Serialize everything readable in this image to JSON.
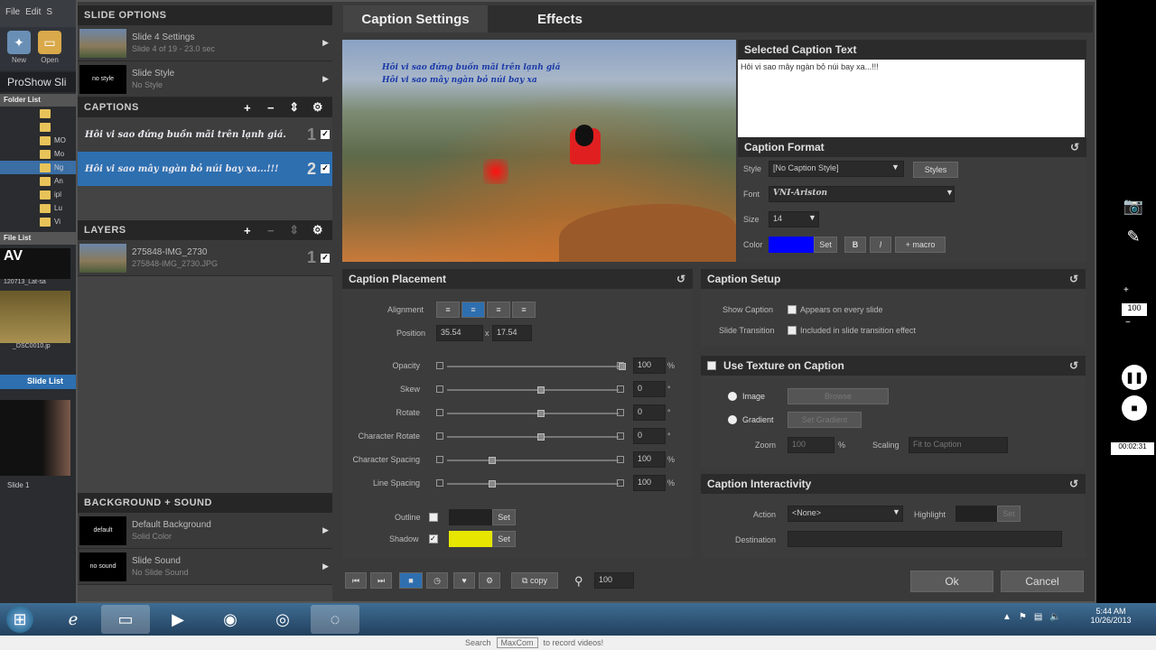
{
  "bg_app": {
    "menu": [
      "File",
      "Edit",
      "S"
    ],
    "tool_new": "New",
    "tool_open": "Open",
    "title": "ProShow Sli",
    "folder_list": "Folder List",
    "folders": [
      "MO",
      "Mo",
      "Ng",
      "An",
      "ipl",
      "Lu",
      "Vi"
    ],
    "file_list": "File List",
    "file1": "120713_Lat-sa",
    "file2": "_DSC0010.jp",
    "slide_list": "Slide List",
    "slide1": "Slide 1"
  },
  "left": {
    "slide_options": "SLIDE OPTIONS",
    "slide_settings": {
      "title": "Slide 4 Settings",
      "sub": "Slide 4 of 19 - 23.0 sec"
    },
    "slide_style": {
      "title": "Slide Style",
      "sub": "No Style",
      "thumb": "no style"
    },
    "captions_header": "CAPTIONS",
    "captions": [
      {
        "text": "Hôi vi sao đứng buồn mãi trên lạnh giá.",
        "num": "1"
      },
      {
        "text": "Hôi vi sao mây ngàn bỏ núi bay xa...!!!",
        "num": "2"
      }
    ],
    "layers_header": "LAYERS",
    "layer": {
      "title": "275848-IMG_2730",
      "sub": "275848-IMG_2730.JPG",
      "num": "1"
    },
    "bg_header": "BACKGROUND + SOUND",
    "default_bg": {
      "title": "Default Background",
      "sub": "Solid Color",
      "thumb": "default"
    },
    "slide_sound": {
      "title": "Slide Sound",
      "sub": "No Slide Sound",
      "thumb": "no sound"
    }
  },
  "tabs": [
    "Caption Settings",
    "Effects"
  ],
  "preview": {
    "line1": "Hôi vi sao đứng buồn mãi trên lạnh giá",
    "line2": "Hôi vi sao mây ngàn bỏ núi bay xa"
  },
  "selected_text": {
    "header": "Selected Caption Text",
    "value": "Hôi vi sao mây ngàn bỏ núi bay xa...!!!"
  },
  "caption_format": {
    "header": "Caption Format",
    "style_label": "Style",
    "style_value": "[No Caption Style]",
    "styles_btn": "Styles",
    "font_label": "Font",
    "font_value": "VNI-Ariston",
    "size_label": "Size",
    "size_value": "14",
    "color_label": "Color",
    "set": "Set",
    "macro": "macro",
    "color": "#0000ff"
  },
  "placement": {
    "header": "Caption Placement",
    "alignment": "Alignment",
    "position": "Position",
    "pos_x": "35.54",
    "pos_y": "17.54",
    "rows": [
      {
        "label": "Opacity",
        "value": "100",
        "unit": "%"
      },
      {
        "label": "Skew",
        "value": "0",
        "unit": "°"
      },
      {
        "label": "Rotate",
        "value": "0",
        "unit": "°"
      },
      {
        "label": "Character Rotate",
        "value": "0",
        "unit": "°"
      },
      {
        "label": "Character Spacing",
        "value": "100",
        "unit": "%"
      },
      {
        "label": "Line Spacing",
        "value": "100",
        "unit": "%"
      }
    ],
    "outline": "Outline",
    "shadow": "Shadow",
    "set": "Set",
    "shadow_color": "#e6e600"
  },
  "setup": {
    "header": "Caption Setup",
    "show": "Show Caption",
    "show_opt": "Appears on every slide",
    "transition": "Slide Transition",
    "trans_opt": "Included in slide transition effect"
  },
  "texture": {
    "header": "Use Texture on Caption",
    "image": "Image",
    "browse": "Browse",
    "gradient": "Gradient",
    "set_gradient": "Set Gradient",
    "zoom": "Zoom",
    "zoom_value": "100",
    "scaling": "Scaling",
    "scaling_value": "Fit to Caption"
  },
  "interactivity": {
    "header": "Caption Interactivity",
    "action": "Action",
    "action_value": "<None>",
    "highlight": "Highlight",
    "set": "Set",
    "destination": "Destination"
  },
  "bottom": {
    "copy": "copy",
    "zoom": "100",
    "ok": "Ok",
    "cancel": "Cancel"
  },
  "overlay": {
    "counter": "100",
    "time": "00:02:31"
  },
  "tray": {
    "time": "5:44 AM",
    "date": "10/26/2013"
  },
  "strip": {
    "search": "Search",
    "field": "MaxCom",
    "tail": "to record videos!"
  }
}
